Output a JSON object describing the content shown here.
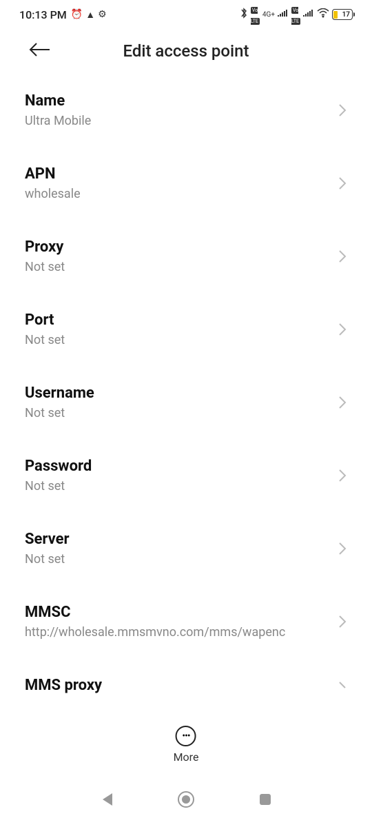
{
  "status_bar": {
    "time": "10:13 PM",
    "network_label_1": "4G+",
    "battery_level": "17"
  },
  "header": {
    "title": "Edit access point"
  },
  "settings": [
    {
      "title": "Name",
      "value": "Ultra Mobile"
    },
    {
      "title": "APN",
      "value": "wholesale"
    },
    {
      "title": "Proxy",
      "value": "Not set"
    },
    {
      "title": "Port",
      "value": "Not set"
    },
    {
      "title": "Username",
      "value": "Not set"
    },
    {
      "title": "Password",
      "value": "Not set"
    },
    {
      "title": "Server",
      "value": "Not set"
    },
    {
      "title": "MMSC",
      "value": "http://wholesale.mmsmvno.com/mms/wapenc"
    },
    {
      "title": "MMS proxy",
      "value": ""
    }
  ],
  "more_label": "More"
}
